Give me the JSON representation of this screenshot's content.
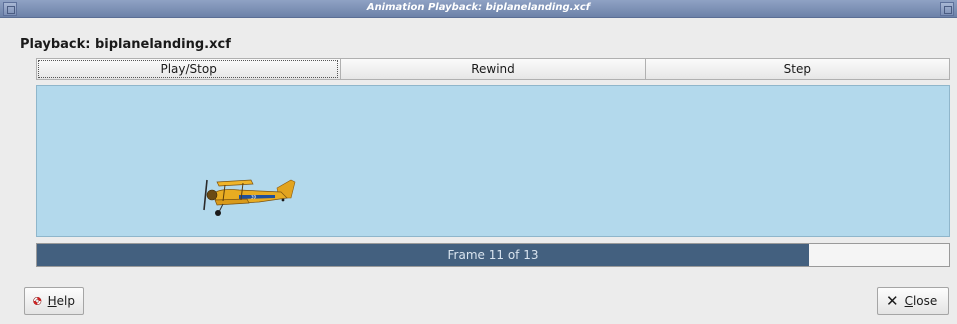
{
  "window": {
    "title": "Animation Playback: biplanelanding.xcf"
  },
  "heading": "Playback: biplanelanding.xcf",
  "controls": {
    "play_stop": "Play/Stop",
    "rewind": "Rewind",
    "step": "Step"
  },
  "preview": {
    "image": "biplane-image",
    "sky_color": "#b3d9ec"
  },
  "progress": {
    "label": "Frame 11 of 13",
    "current_frame": 11,
    "total_frames": 13,
    "fill_color": "#43607f"
  },
  "footer": {
    "help_mnemonic": "H",
    "help_rest": "elp",
    "close_mnemonic": "C",
    "close_rest": "lose",
    "help_icon": "lifebuoy-icon",
    "close_icon": "x-icon"
  }
}
